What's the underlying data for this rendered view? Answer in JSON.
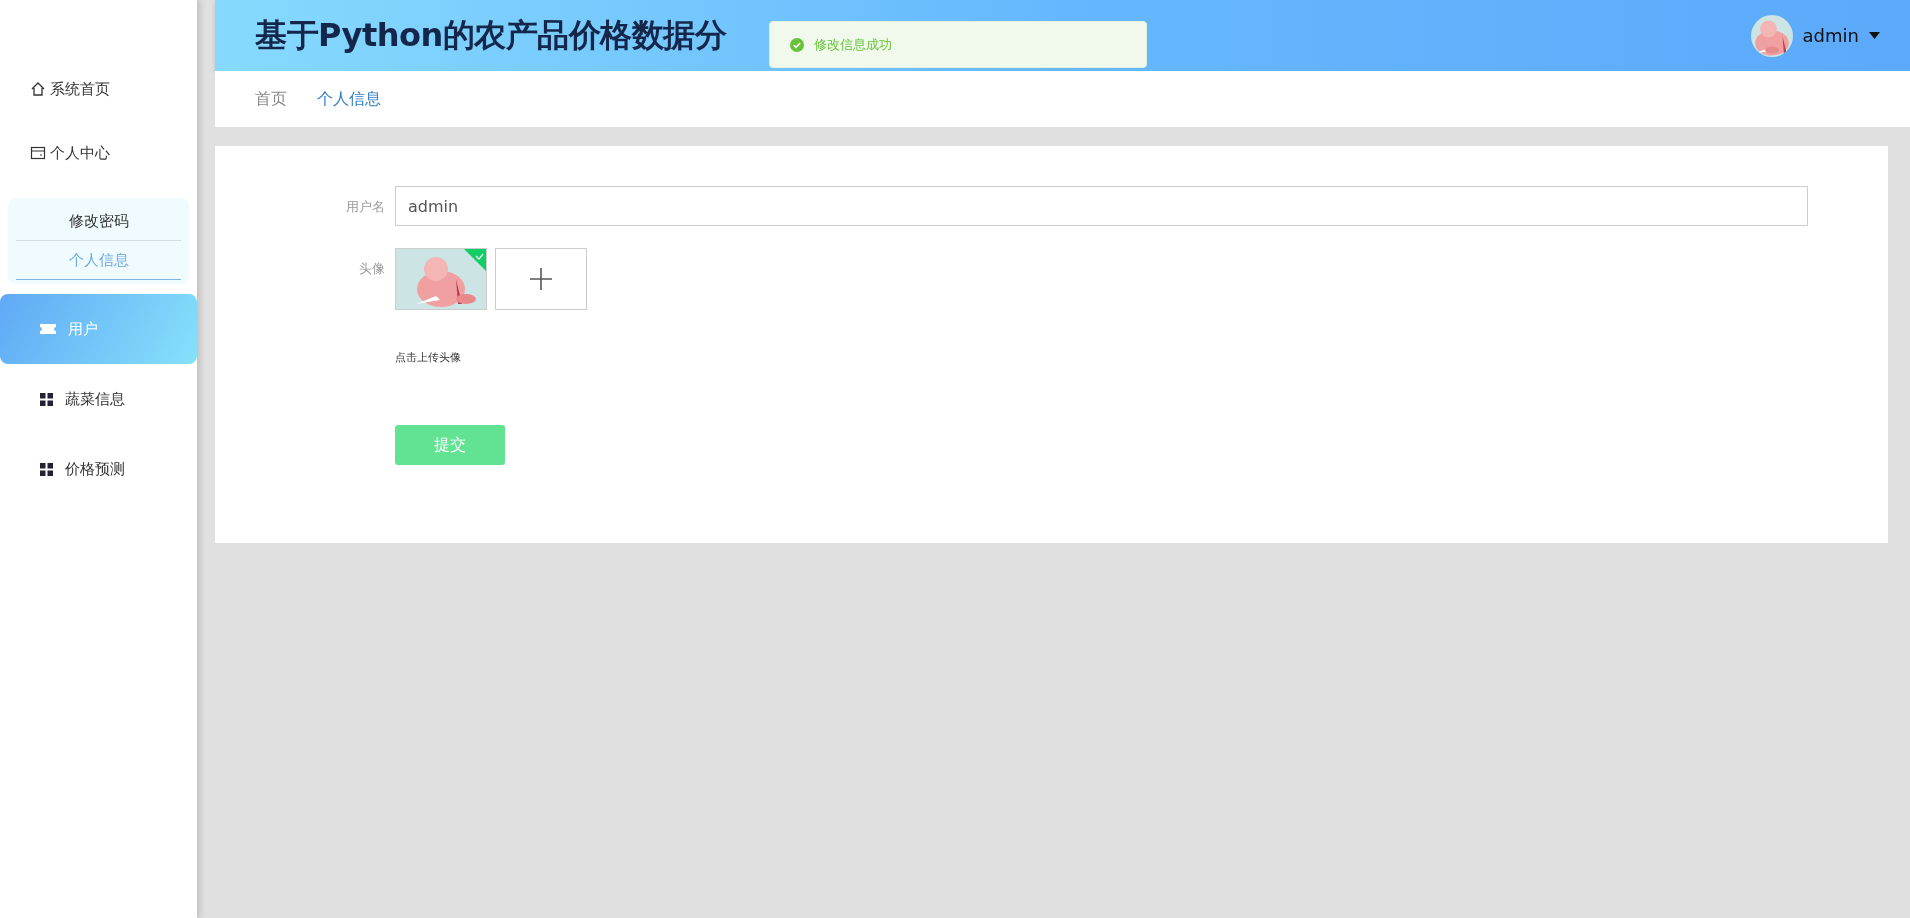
{
  "sidebar": {
    "items": [
      {
        "kind": "home",
        "label": "系统首页",
        "selected": false
      },
      {
        "kind": "account",
        "label": "个人中心",
        "selected": false,
        "expanded": true,
        "children": [
          {
            "label": "修改密码",
            "selected": false
          },
          {
            "label": "个人信息",
            "selected": true
          }
        ]
      },
      {
        "kind": "ticket",
        "label": "用户",
        "selected": true
      },
      {
        "kind": "grid",
        "label": "蔬菜信息",
        "selected": false
      },
      {
        "kind": "grid",
        "label": "价格预测",
        "selected": false
      }
    ]
  },
  "header": {
    "title": "基于Python的农产品价格数据分",
    "user": "admin"
  },
  "toast": {
    "message": "修改信息成功"
  },
  "breadcrumb": [
    {
      "label": "首页",
      "selected": false
    },
    {
      "label": "个人信息",
      "selected": true
    }
  ],
  "form": {
    "fields": [
      {
        "kind": "text",
        "label": "用户名",
        "value": "admin"
      },
      {
        "label": "头像",
        "hint": "点击上传头像"
      }
    ],
    "submit": "提交"
  }
}
